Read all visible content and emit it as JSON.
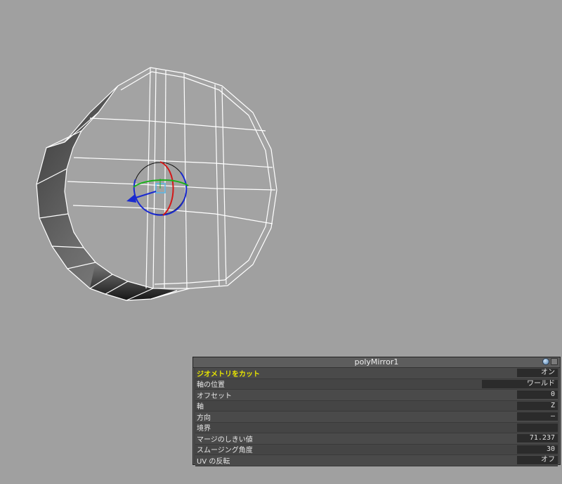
{
  "panel": {
    "title": "polyMirror1",
    "rows": [
      {
        "label": "ジオメトリをカット",
        "value": "オン",
        "highlight": true
      },
      {
        "label": "軸の位置",
        "value": "ワールド"
      },
      {
        "label": "オフセット",
        "value": "0"
      },
      {
        "label": "軸",
        "value": "Z"
      },
      {
        "label": "方向",
        "value": "–"
      },
      {
        "label": "境界",
        "value": ""
      },
      {
        "label": "マージのしきい値",
        "value": "71.237"
      },
      {
        "label": "スムージング角度",
        "value": "30"
      },
      {
        "label": "UV の反転",
        "value": "オフ"
      }
    ]
  },
  "icons": [
    "globe-icon",
    "close-box-icon"
  ],
  "colors": {
    "background": "#a0a0a0",
    "panel": "#444444",
    "highlight_label": "#e8e500",
    "wire": "#ffffff"
  }
}
